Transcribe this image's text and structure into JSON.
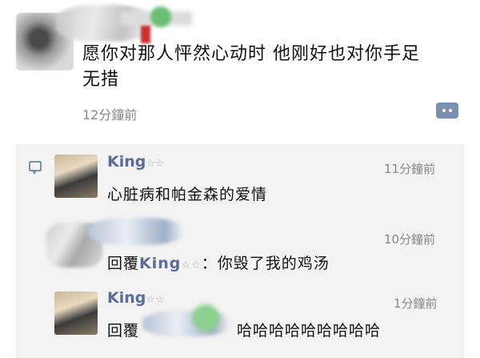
{
  "post": {
    "text_line1": "愿你对那人怦然心动时 他刚好也对你手足",
    "text_line2": "无措",
    "time": "12分鐘前",
    "more_icon": "ellipsis-icon"
  },
  "comments": [
    {
      "name": "King",
      "name_deco": "☆☆",
      "time": "11分鐘前",
      "text": "心脏病和帕金森的爱情"
    },
    {
      "time": "10分鐘前",
      "reply_prefix": "回覆",
      "reply_to": "King",
      "name_deco": "☆☆",
      "reply_text": "：你毁了我的鸡汤"
    },
    {
      "name": "King",
      "name_deco": "☆☆",
      "time": "1分鐘前",
      "reply_prefix": "回覆",
      "reply_text": "哈哈哈哈哈哈哈哈哈"
    }
  ],
  "colors": {
    "link_blue": "#5a6d95",
    "icon_blue": "#7b8fb1",
    "comment_bg": "#f3f3f3",
    "time_gray": "#888888"
  }
}
